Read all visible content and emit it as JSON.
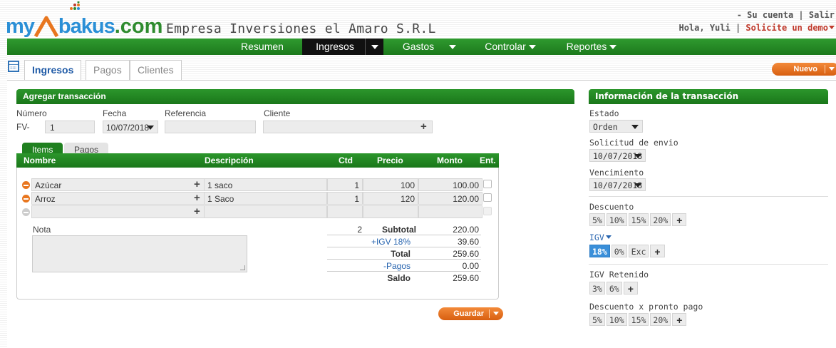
{
  "header": {
    "logo_my": "my",
    "logo_a": "A",
    "logo_bakus": "bakus",
    "logo_com": ".com",
    "company": "Empresa Inversiones el Amaro S.R.L",
    "account_links": "- Su cuenta | Salir",
    "greeting": "Hola, Yuli |",
    "demo_link": "Solicite un demo"
  },
  "nav": {
    "resumen": "Resumen",
    "ingresos": "Ingresos",
    "gastos": "Gastos",
    "controlar": "Controlar",
    "reportes": "Reportes"
  },
  "tabs": {
    "ingresos": "Ingresos",
    "pagos": "Pagos",
    "clientes": "Clientes",
    "nuevo": "Nuevo"
  },
  "form": {
    "title": "Agregar transacción",
    "numero_label": "Número",
    "numero_prefix": "FV-",
    "numero_value": "1",
    "fecha_label": "Fecha",
    "fecha_value": "10/07/2018",
    "referencia_label": "Referencia",
    "referencia_value": "",
    "cliente_label": "Cliente",
    "cliente_value": ""
  },
  "items": {
    "subtabs": [
      "Items",
      "Pagos"
    ],
    "headers": [
      "Nombre",
      "Descripción",
      "Ctd",
      "Precio",
      "Monto",
      "Ent."
    ],
    "rows": [
      {
        "name": "Azúcar",
        "description": "1 saco",
        "qty": "1",
        "price": "100",
        "amount": "100.00"
      },
      {
        "name": "Arroz",
        "description": "1 Saco",
        "qty": "1",
        "price": "120",
        "amount": "120.00"
      },
      {
        "name": "",
        "description": "",
        "qty": "",
        "price": "",
        "amount": ""
      }
    ],
    "note_label": "Nota",
    "count": "2",
    "subtotal_label": "Subtotal",
    "subtotal": "220.00",
    "igv_label": "+IGV 18%",
    "igv": "39.60",
    "total_label": "Total",
    "total": "259.60",
    "pagos_label": "-Pagos",
    "pagos": "0.00",
    "saldo_label": "Saldo",
    "saldo": "259.60",
    "save": "Guardar"
  },
  "info": {
    "title": "Información de la transacción",
    "estado_label": "Estado",
    "estado_value": "Orden",
    "envio_label": "Solicitud de envio",
    "envio_value": "10/07/2018",
    "venc_label": "Vencimiento",
    "venc_value": "10/07/2018",
    "descuento_label": "Descuento",
    "descuento_options": [
      "5%",
      "10%",
      "15%",
      "20%"
    ],
    "igv_label": "IGV",
    "igv_options": [
      "18%",
      "0%",
      "Exc"
    ],
    "igv_selected": "18%",
    "igv_ret_label": "IGV Retenido",
    "igv_ret_options": [
      "3%",
      "6%"
    ],
    "pronto_label": "Descuento x pronto pago",
    "pronto_options": [
      "5%",
      "10%",
      "15%",
      "20%"
    ]
  },
  "colors": {
    "green": "#1f801f",
    "orange": "#e06a15",
    "blue_link": "#2a66b0",
    "selected_blue": "#3a8fd9"
  }
}
